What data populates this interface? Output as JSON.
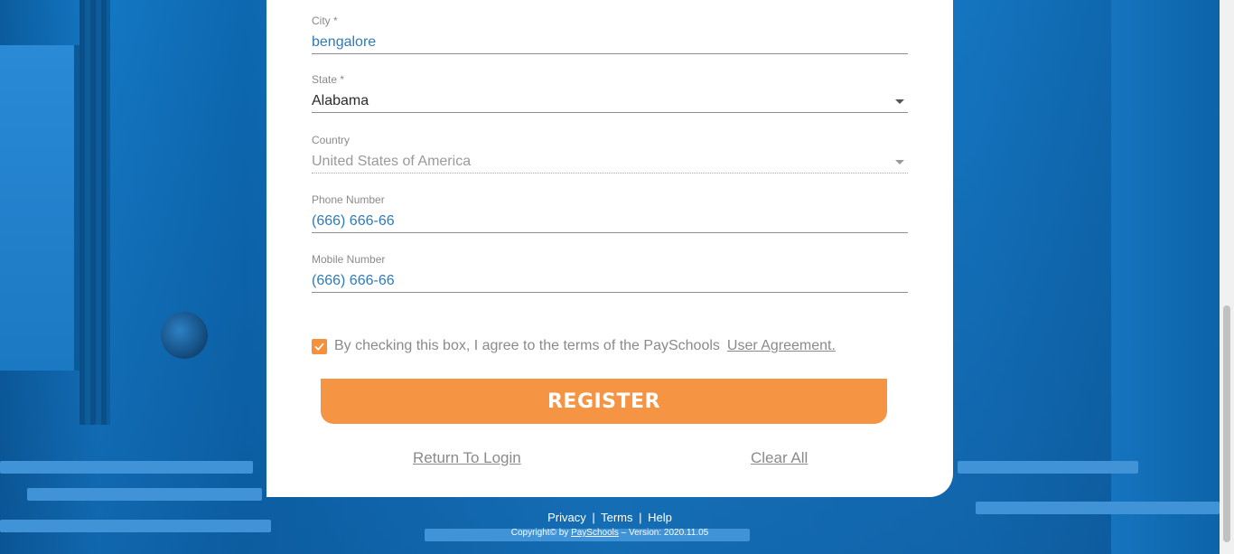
{
  "form": {
    "city": {
      "label": "City *",
      "value": "bengalore"
    },
    "state": {
      "label": "State *",
      "value": "Alabama"
    },
    "country": {
      "label": "Country",
      "value": "United States of America"
    },
    "phone": {
      "label": "Phone Number",
      "value": "(666) 666-66"
    },
    "mobile": {
      "label": "Mobile Number",
      "value": "(666) 666-66"
    },
    "agree": {
      "checked": true,
      "text": "By checking this box, I agree to the terms of the PaySchools",
      "link": "User Agreement."
    },
    "register_label": "REGISTER",
    "return_label": "Return To Login",
    "clear_label": "Clear All"
  },
  "footer": {
    "privacy": "Privacy",
    "terms": "Terms",
    "help": "Help",
    "separator": "|",
    "copyright_prefix": "Copyright© by",
    "brand": "PaySchools",
    "version": "– Version: 2020.11.05"
  },
  "colors": {
    "accent": "#f59544",
    "value_text": "#2f7ab8",
    "background": "#0f6fb5"
  }
}
